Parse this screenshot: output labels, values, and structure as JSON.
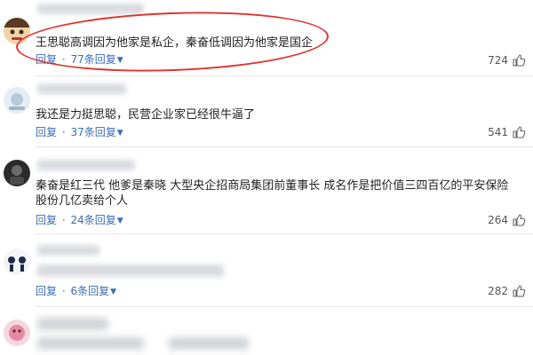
{
  "comments": [
    {
      "text": "王思聪高调因为他家是私企，秦奋低调因为他家是国企",
      "reply_label": "回复",
      "separator": "·",
      "replies_label": "77条回复",
      "likes": "724"
    },
    {
      "text": "我还是力挺思聪，民营企业家已经很牛逼了",
      "reply_label": "回复",
      "separator": "·",
      "replies_label": "37条回复",
      "likes": "541"
    },
    {
      "text": "秦奋是红三代 他爹是秦晓 大型央企招商局集团前董事长 成名作是把价值三四百亿的平安保险股份几亿卖给个人",
      "reply_label": "回复",
      "separator": "·",
      "replies_label": "24条回复",
      "likes": "264"
    },
    {
      "text": "",
      "reply_label": "回复",
      "separator": "·",
      "replies_label": "6条回复",
      "likes": "282"
    }
  ],
  "icons": {
    "like": "thumbs-up-icon",
    "expand": "chevron-down-icon"
  },
  "colors": {
    "link": "#3b6db6",
    "highlight_ring": "#e0322e",
    "separator": "#e9e9e9"
  }
}
